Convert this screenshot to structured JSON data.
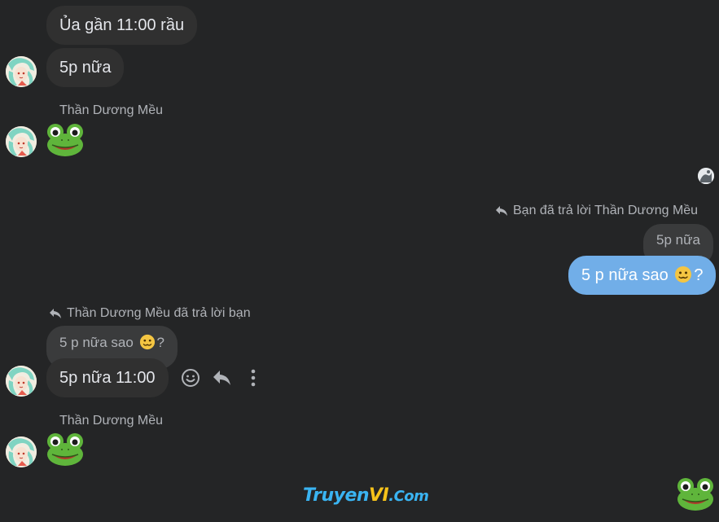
{
  "other_user": {
    "name": "Thần Dương Mều"
  },
  "messages": {
    "m1": "Ủa gần 11:00 rầu",
    "m2": "5p nữa",
    "m3_sender": "Thần Dương Mều",
    "my_reply_note": "Bạn đã trả lời Thần Dương Mều",
    "my_quote": "5p nữa",
    "my_msg_text": "5 p nữa sao",
    "my_msg_suffix": "?",
    "their_reply_note": "Thần Dương Mều đã trả lời bạn",
    "their_quote_text": "5 p nữa sao",
    "their_quote_suffix": "?",
    "their_msg": "5p nữa 11:00",
    "m6_sender": "Thần Dương Mều"
  },
  "icons": {
    "sticker": "frog-emoji",
    "inline_emoji": "woozy-face-emoji",
    "react": "smiley-icon",
    "reply": "reply-icon",
    "more": "more-vertical-icon"
  },
  "watermark": {
    "part1": "Truyen",
    "part2": "VI",
    "part3": ".Com"
  },
  "colors": {
    "background": "#242526",
    "bubble_other": "#303030",
    "bubble_mine": "#71aee8",
    "text_secondary": "#b0b3b8"
  }
}
